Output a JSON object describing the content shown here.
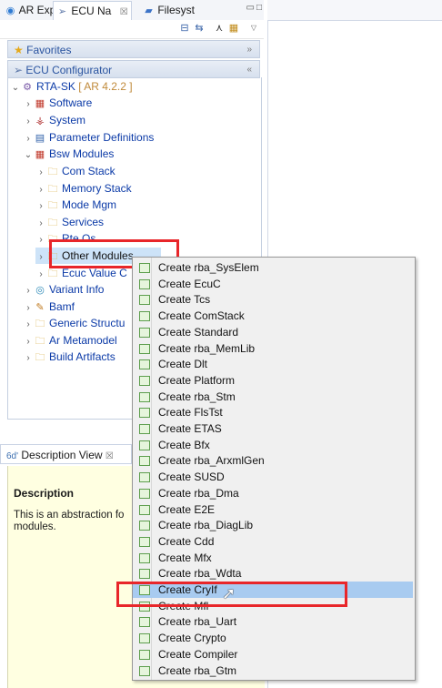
{
  "tabs": [
    {
      "label": "AR Expl",
      "icon": "ar-explorer-icon"
    },
    {
      "label": "ECU Na",
      "icon": "ecu-navigator-icon",
      "close": "☒"
    },
    {
      "label": "Filesyst",
      "icon": "filesystem-icon"
    }
  ],
  "sections": {
    "favorites": "Favorites",
    "ecu_configurator": "ECU Configurator"
  },
  "tree": {
    "root_label": "RTA-SK",
    "root_suffix": " [ AR 4.2.2 ]",
    "items": [
      {
        "label": "Software",
        "icon": "software-icon"
      },
      {
        "label": "System",
        "icon": "system-icon"
      },
      {
        "label": "Parameter Definitions",
        "icon": "parameter-definitions-icon"
      },
      {
        "label": "Bsw Modules",
        "icon": "bsw-modules-icon"
      },
      {
        "label": "Com Stack",
        "icon": "folder-icon"
      },
      {
        "label": "Memory Stack",
        "icon": "folder-icon"
      },
      {
        "label": "Mode Mgm",
        "icon": "folder-icon"
      },
      {
        "label": "Services",
        "icon": "folder-icon"
      },
      {
        "label": "Rte Os",
        "icon": "folder-icon"
      },
      {
        "label": "Other Modules",
        "icon": "folder-icon"
      },
      {
        "label": "Ecuc Value C",
        "icon": "folder-icon"
      },
      {
        "label": "Variant Info",
        "icon": "variant-info-icon"
      },
      {
        "label": "Bamf",
        "icon": "bamf-icon"
      },
      {
        "label": "Generic Structu",
        "icon": "folder-icon"
      },
      {
        "label": "Ar Metamodel",
        "icon": "folder-icon"
      },
      {
        "label": "Build Artifacts",
        "icon": "folder-icon"
      }
    ]
  },
  "description": {
    "tab_label": "Description View",
    "title": "Description",
    "text": "This is an abstraction fo modules."
  },
  "context_menu": {
    "items": [
      "Create rba_SysElem",
      "Create EcuC",
      "Create Tcs",
      "Create ComStack",
      "Create Standard",
      "Create rba_MemLib",
      "Create Dlt",
      "Create Platform",
      "Create rba_Stm",
      "Create FlsTst",
      "Create ETAS",
      "Create Bfx",
      "Create rba_ArxmlGen",
      "Create SUSD",
      "Create rba_Dma",
      "Create E2E",
      "Create rba_DiagLib",
      "Create Cdd",
      "Create Mfx",
      "Create rba_Wdta",
      "Create CryIf",
      "Create Mfl",
      "Create rba_Uart",
      "Create Crypto",
      "Create Compiler",
      "Create rba_Gtm"
    ],
    "highlighted": "Create CryIf"
  },
  "colors": {
    "accent": "#e8262a",
    "highlight": "#a8cbf0",
    "tree_text": "#0b3aa7",
    "description_bg": "#ffffe1"
  }
}
